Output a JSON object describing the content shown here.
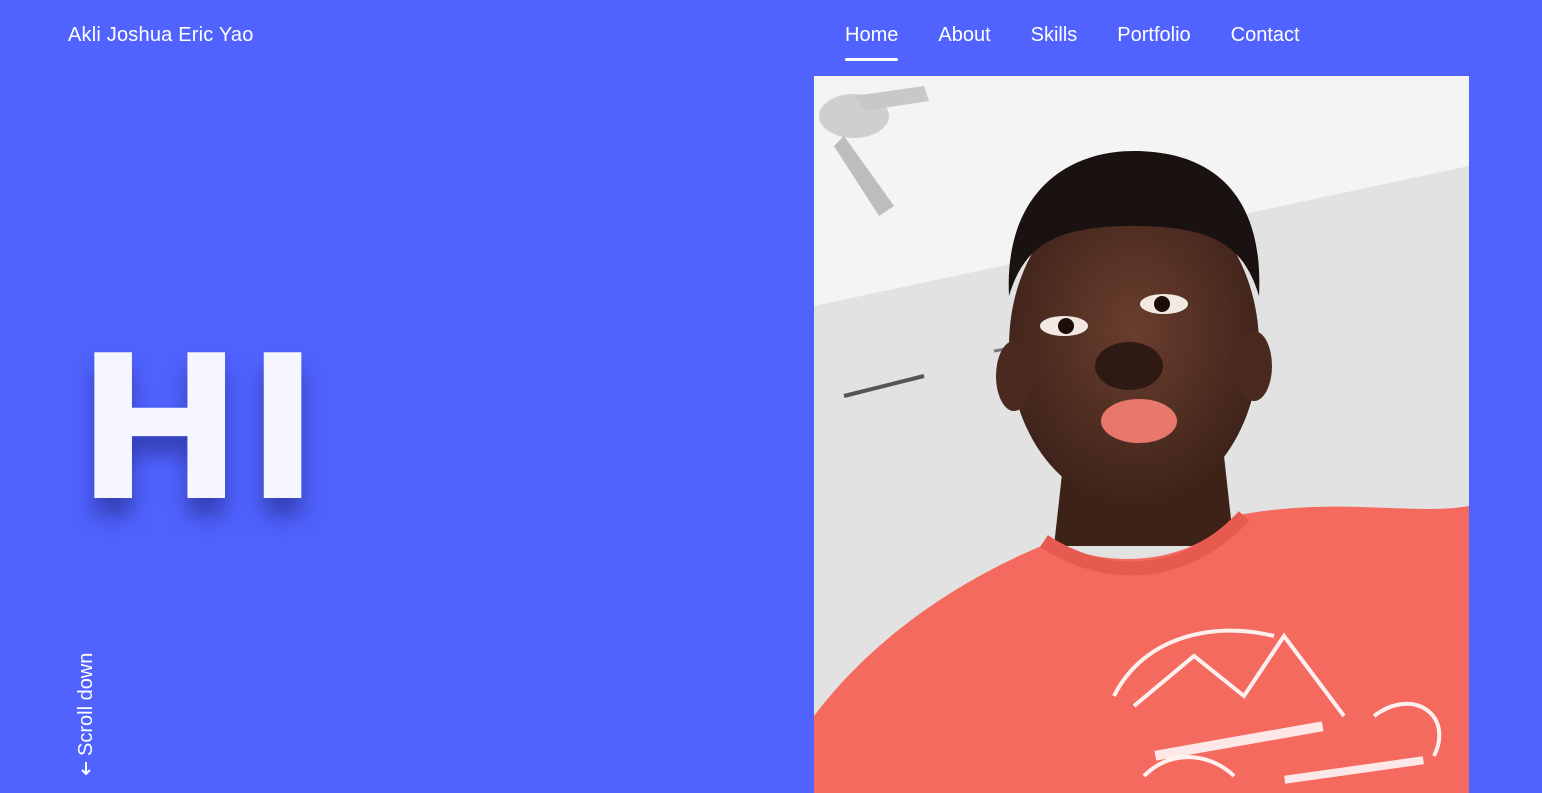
{
  "header": {
    "brand": "Akli Joshua Eric Yao"
  },
  "nav": {
    "items": [
      {
        "label": "Home",
        "active": true
      },
      {
        "label": "About",
        "active": false
      },
      {
        "label": "Skills",
        "active": false
      },
      {
        "label": "Portfolio",
        "active": false
      },
      {
        "label": "Contact",
        "active": false
      }
    ]
  },
  "hero": {
    "greeting": "HI",
    "scroll_label": "Scroll down",
    "scroll_icon": "arrow-down-icon",
    "photo_icon": "profile-photo"
  },
  "colors": {
    "background": "#5063FF",
    "text": "#FFFFFF",
    "shirt": "#F46A5E"
  }
}
